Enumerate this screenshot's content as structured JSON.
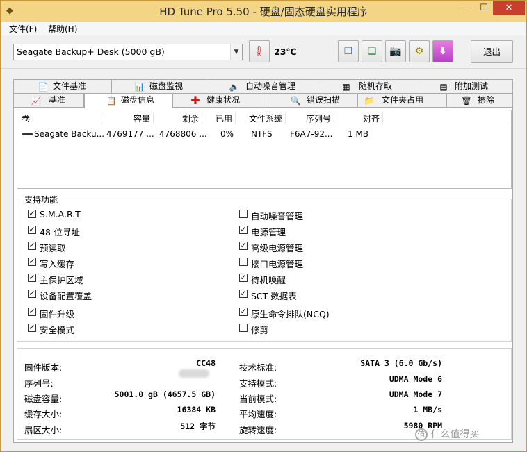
{
  "window": {
    "title": "HD Tune Pro 5.50 - 硬盘/固态硬盘实用程序",
    "title_bg": "#f4d485",
    "close_color": "#c7402d"
  },
  "menu": {
    "file": "文件(F)",
    "help": "帮助(H)"
  },
  "toolbar": {
    "drive": "Seagate Backup+  Desk (5000 gB)",
    "temperature": "23℃",
    "exit": "退出",
    "icons": [
      "thermometer-icon",
      "copy-text-icon",
      "copy-screen-icon",
      "camera-icon",
      "options-icon",
      "save-down-icon"
    ]
  },
  "tabs": {
    "row1": [
      "文件基准",
      "磁盘监视",
      "自动噪音管理",
      "随机存取",
      "附加测试"
    ],
    "row2": [
      "基准",
      "磁盘信息",
      "健康状况",
      "错误扫描",
      "文件夹占用",
      "擦除"
    ],
    "active": "磁盘信息"
  },
  "volume_table": {
    "headers": [
      "卷",
      "容量",
      "剩余",
      "已用",
      "文件系统",
      "序列号",
      "对齐"
    ],
    "rows": [
      [
        "Seagate Backu...",
        "4769177 ...",
        "4768806 ...",
        "0%",
        "NTFS",
        "F6A7-92...",
        "1 MB"
      ]
    ]
  },
  "features": {
    "title": "支持功能",
    "left": [
      {
        "label": "S.M.A.R.T",
        "checked": true
      },
      {
        "label": "48-位寻址",
        "checked": true
      },
      {
        "label": "预读取",
        "checked": true
      },
      {
        "label": "写入缓存",
        "checked": true
      },
      {
        "label": "主保护区域",
        "checked": true
      },
      {
        "label": "设备配置覆盖",
        "checked": true
      },
      {
        "label": "固件升级",
        "checked": true
      },
      {
        "label": "安全模式",
        "checked": true
      }
    ],
    "right": [
      {
        "label": "自动噪音管理",
        "checked": false
      },
      {
        "label": "电源管理",
        "checked": true
      },
      {
        "label": "高级电源管理",
        "checked": true
      },
      {
        "label": "接口电源管理",
        "checked": false
      },
      {
        "label": "待机唤醒",
        "checked": true
      },
      {
        "label": "SCT 数据表",
        "checked": true
      },
      {
        "label": "原生命令排队(NCQ)",
        "checked": true
      },
      {
        "label": "修剪",
        "checked": false
      }
    ]
  },
  "info": {
    "left": [
      {
        "label": "固件版本:",
        "value": "CC48"
      },
      {
        "label": "序列号:",
        "value": ""
      },
      {
        "label": "磁盘容量:",
        "value": "5001.0 gB (4657.5 GB)"
      },
      {
        "label": "缓存大小:",
        "value": "16384 KB"
      },
      {
        "label": "扇区大小:",
        "value": "512 字节"
      }
    ],
    "right": [
      {
        "label": "技术标准:",
        "value": "SATA 3 (6.0 Gb/s)"
      },
      {
        "label": "支持模式:",
        "value": "UDMA Mode 6"
      },
      {
        "label": "当前模式:",
        "value": "UDMA Mode 7"
      },
      {
        "label": "平均速度:",
        "value": "1 MB/s"
      },
      {
        "label": "旋转速度:",
        "value": "5980 RPM"
      }
    ]
  },
  "watermark": "值 什么值得买"
}
